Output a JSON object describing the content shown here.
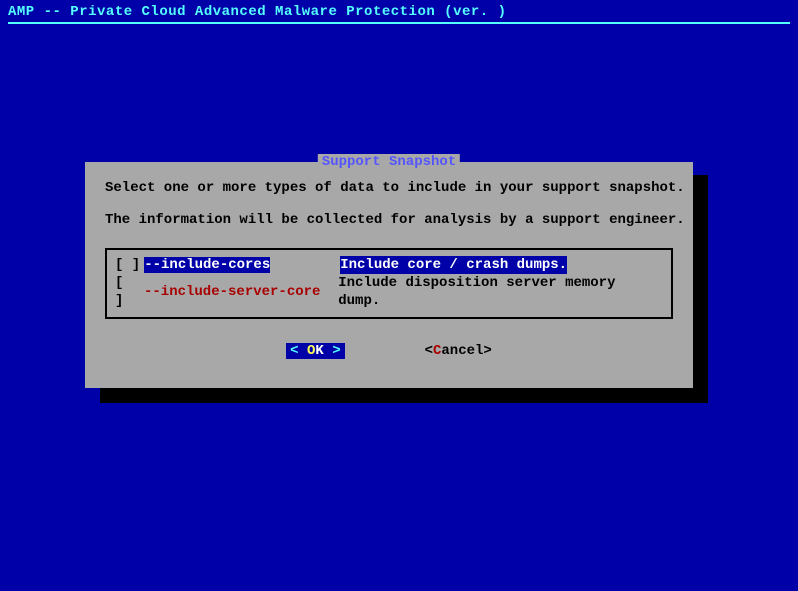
{
  "header": {
    "title": "AMP -- Private Cloud Advanced Malware Protection (ver. )"
  },
  "dialog": {
    "title": "Support Snapshot",
    "instruction1": "Select one or more types of data to include in your support snapshot.",
    "instruction2": "The information will be collected for analysis by a support engineer.",
    "options": [
      {
        "checkbox": "[ ]",
        "flag": "--include-cores",
        "desc": "Include core / crash dumps.",
        "selected": true
      },
      {
        "checkbox": "[ ]",
        "flag": "--include-server-core",
        "desc": "Include disposition server memory dump.",
        "selected": false
      }
    ],
    "buttons": {
      "ok": {
        "left_bracket": "<",
        "right_bracket": ">",
        "space": " ",
        "hotkey": "O",
        "rest": "K"
      },
      "cancel": {
        "left_bracket": "<",
        "right_bracket": ">",
        "hotkey": "C",
        "rest": "ancel"
      }
    }
  }
}
